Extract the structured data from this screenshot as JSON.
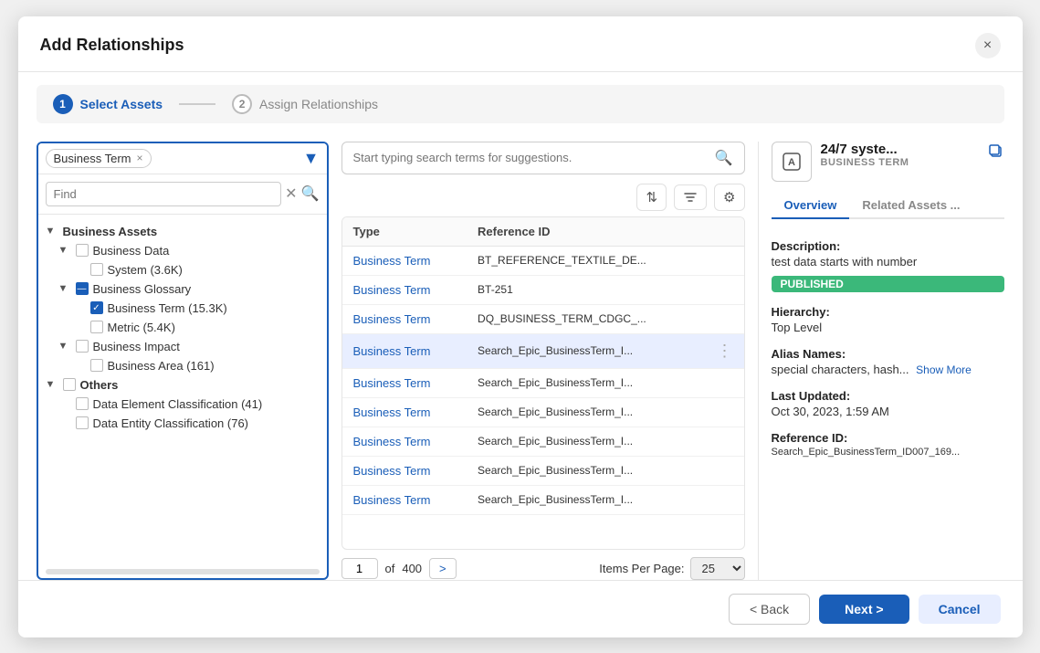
{
  "modal": {
    "title": "Add Relationships",
    "close_label": "×"
  },
  "steps": [
    {
      "number": "1",
      "label": "Select Assets",
      "active": true
    },
    {
      "number": "2",
      "label": "Assign Relationships",
      "active": false
    }
  ],
  "left_panel": {
    "tag": "Business Term",
    "find_placeholder": "Find",
    "tree": [
      {
        "level": 0,
        "chevron": "▼",
        "checkbox": "none",
        "label": "Business Assets",
        "expanded": true
      },
      {
        "level": 1,
        "chevron": "▼",
        "checkbox": "unchecked",
        "label": "Business Data",
        "expanded": true
      },
      {
        "level": 2,
        "chevron": "",
        "checkbox": "unchecked",
        "label": "System (3.6K)"
      },
      {
        "level": 1,
        "chevron": "▼",
        "checkbox": "indeterminate",
        "label": "Business Glossary",
        "expanded": true
      },
      {
        "level": 2,
        "chevron": "",
        "checkbox": "checked",
        "label": "Business Term (15.3K)"
      },
      {
        "level": 2,
        "chevron": "",
        "checkbox": "unchecked",
        "label": "Metric (5.4K)"
      },
      {
        "level": 1,
        "chevron": "▼",
        "checkbox": "unchecked",
        "label": "Business Impact",
        "expanded": true
      },
      {
        "level": 2,
        "chevron": "",
        "checkbox": "unchecked",
        "label": "Business Area (161)"
      },
      {
        "level": 0,
        "chevron": "▼",
        "checkbox": "unchecked",
        "label": "Others",
        "expanded": true
      },
      {
        "level": 1,
        "chevron": "",
        "checkbox": "unchecked",
        "label": "Data Element Classification (41)"
      },
      {
        "level": 1,
        "chevron": "",
        "checkbox": "unchecked",
        "label": "Data Entity Classification (76)"
      }
    ]
  },
  "search": {
    "placeholder": "Start typing search terms for suggestions."
  },
  "table": {
    "columns": [
      "Type",
      "Reference ID"
    ],
    "rows": [
      {
        "type": "Business Term",
        "ref": "BT_REFERENCE_TEXTILE_DE...",
        "selected": false
      },
      {
        "type": "Business Term",
        "ref": "BT-251",
        "selected": false
      },
      {
        "type": "Business Term",
        "ref": "DQ_BUSINESS_TERM_CDGC_...",
        "selected": false
      },
      {
        "type": "Business Term",
        "ref": "Search_Epic_BusinessTerm_I...",
        "selected": true
      },
      {
        "type": "Business Term",
        "ref": "Search_Epic_BusinessTerm_I...",
        "selected": false
      },
      {
        "type": "Business Term",
        "ref": "Search_Epic_BusinessTerm_I...",
        "selected": false
      },
      {
        "type": "Business Term",
        "ref": "Search_Epic_BusinessTerm_I...",
        "selected": false
      },
      {
        "type": "Business Term",
        "ref": "Search_Epic_BusinessTerm_I...",
        "selected": false
      },
      {
        "type": "Business Term",
        "ref": "Search_Epic_BusinessTerm_I...",
        "selected": false
      }
    ],
    "current_page": "1",
    "total_pages": "400",
    "items_per_page": "25"
  },
  "right_panel": {
    "asset_name": "24/7 syste...",
    "asset_type": "BUSINESS TERM",
    "tabs": [
      "Overview",
      "Related Assets ..."
    ],
    "active_tab": "Overview",
    "description_label": "Description:",
    "description_value": "test data starts with number",
    "status_badge": "PUBLISHED",
    "hierarchy_label": "Hierarchy:",
    "hierarchy_value": "Top Level",
    "alias_label": "Alias Names:",
    "alias_value": "special characters, hash...",
    "show_more": "Show More",
    "last_updated_label": "Last Updated:",
    "last_updated_value": "Oct 30, 2023, 1:59 AM",
    "reference_id_label": "Reference ID:",
    "reference_id_value": "Search_Epic_BusinessTerm_ID007_169..."
  },
  "footer": {
    "back_label": "< Back",
    "next_label": "Next >",
    "cancel_label": "Cancel"
  }
}
